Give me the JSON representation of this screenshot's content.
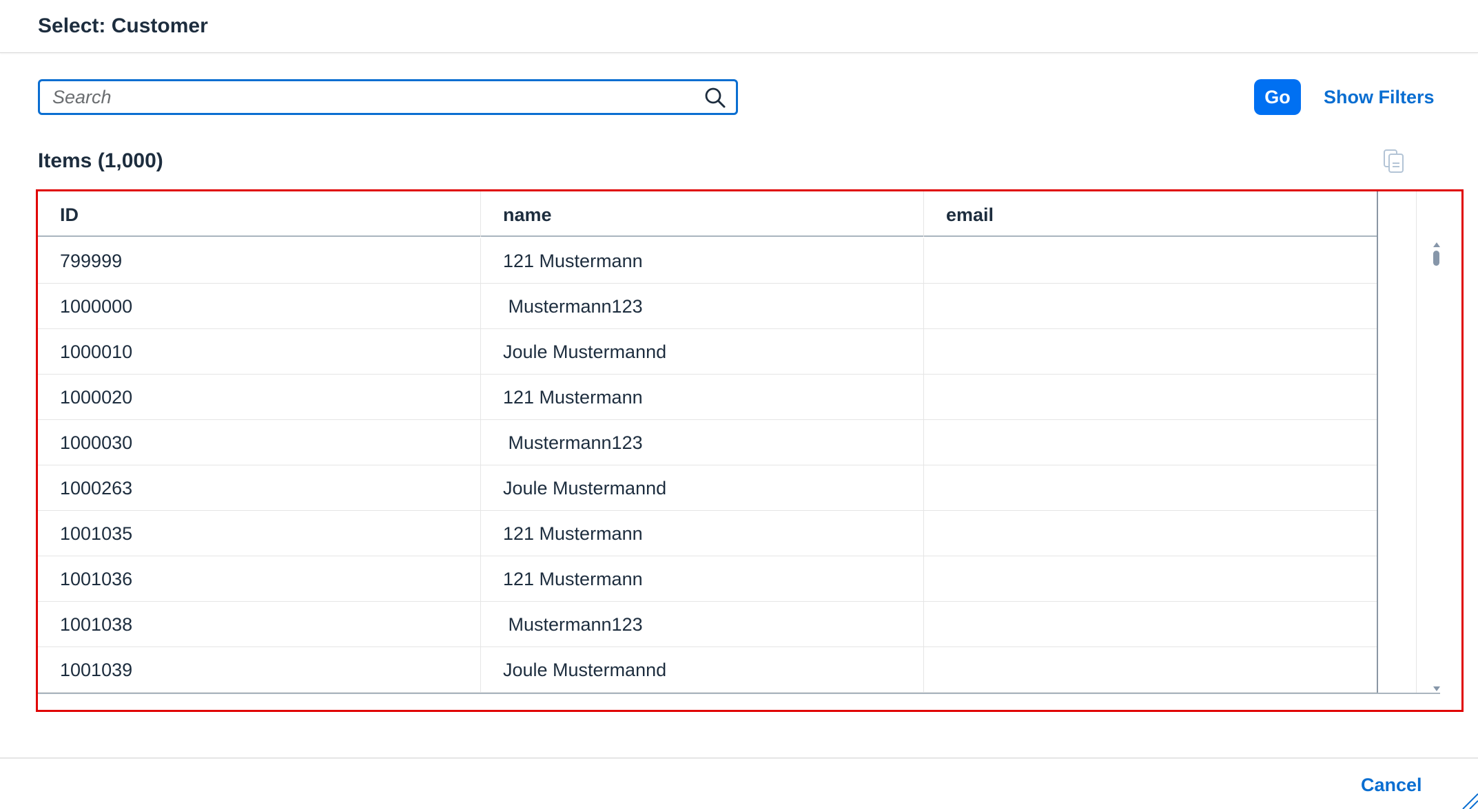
{
  "dialog": {
    "title": "Select: Customer"
  },
  "search": {
    "placeholder": "Search",
    "value": ""
  },
  "toolbar": {
    "go_label": "Go",
    "filters_label": "Show Filters"
  },
  "table": {
    "title": "Items (1,000)",
    "columns": [
      "ID",
      "name",
      "email"
    ],
    "rows": [
      {
        "id": "799999",
        "name": "121 Mustermann",
        "email": ""
      },
      {
        "id": "1000000",
        "name": " Mustermann123",
        "email": ""
      },
      {
        "id": "1000010",
        "name": "Joule Mustermannd",
        "email": ""
      },
      {
        "id": "1000020",
        "name": "121 Mustermann",
        "email": ""
      },
      {
        "id": "1000030",
        "name": " Mustermann123",
        "email": ""
      },
      {
        "id": "1000263",
        "name": "Joule Mustermannd",
        "email": ""
      },
      {
        "id": "1001035",
        "name": "121 Mustermann",
        "email": ""
      },
      {
        "id": "1001036",
        "name": "121 Mustermann",
        "email": ""
      },
      {
        "id": "1001038",
        "name": " Mustermann123",
        "email": ""
      },
      {
        "id": "1001039",
        "name": "Joule Mustermannd",
        "email": ""
      }
    ]
  },
  "footer": {
    "cancel_label": "Cancel"
  },
  "colors": {
    "accent": "#0a6ed1",
    "button": "#0070f2",
    "highlight_border": "#e00000"
  },
  "icons": {
    "search": "search-icon",
    "copy": "copy-icon",
    "resize": "resize-handle-icon"
  }
}
